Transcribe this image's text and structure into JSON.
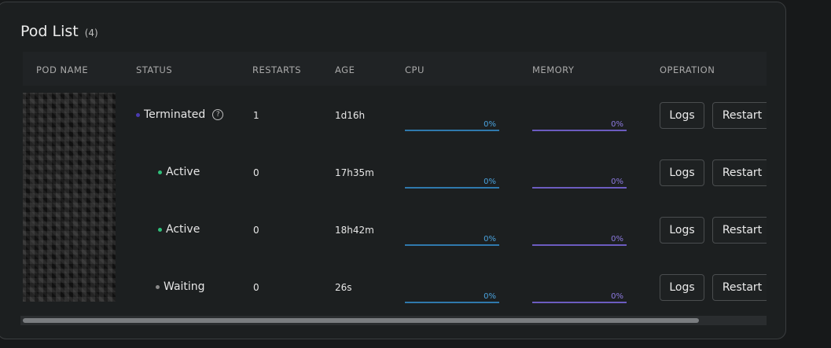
{
  "panel": {
    "title": "Pod List",
    "count": "(4)"
  },
  "columns": {
    "pod_name": "POD NAME",
    "status": "STATUS",
    "restarts": "RESTARTS",
    "age": "AGE",
    "cpu": "CPU",
    "memory": "MEMORY",
    "operation": "OPERATION"
  },
  "rows": [
    {
      "status": "Terminated",
      "status_color": "#4a3bb0",
      "restarts": "1",
      "age": "1d16h",
      "cpu": "0%",
      "memory": "0%",
      "cpu_fraction": 0,
      "memory_fraction": 0,
      "logs_label": "Logs",
      "restart_label": "Restart",
      "help": "?"
    },
    {
      "status": "Active",
      "status_color": "#2fbf7a",
      "restarts": "0",
      "age": "17h35m",
      "cpu": "0%",
      "memory": "0%",
      "cpu_fraction": 0,
      "memory_fraction": 0,
      "logs_label": "Logs",
      "restart_label": "Restart"
    },
    {
      "status": "Active",
      "status_color": "#2fbf7a",
      "restarts": "0",
      "age": "18h42m",
      "cpu": "0%",
      "memory": "0%",
      "cpu_fraction": 0,
      "memory_fraction": 0,
      "logs_label": "Logs",
      "restart_label": "Restart"
    },
    {
      "status": "Waiting",
      "status_color": "#8a8a8a",
      "restarts": "0",
      "age": "26s",
      "cpu": "0%",
      "memory": "0%",
      "cpu_fraction": 0,
      "memory_fraction": 0,
      "logs_label": "Logs",
      "restart_label": "Restart"
    }
  ],
  "scrollbar": {
    "position_fraction": 0.0,
    "visible_fraction": 0.91
  }
}
